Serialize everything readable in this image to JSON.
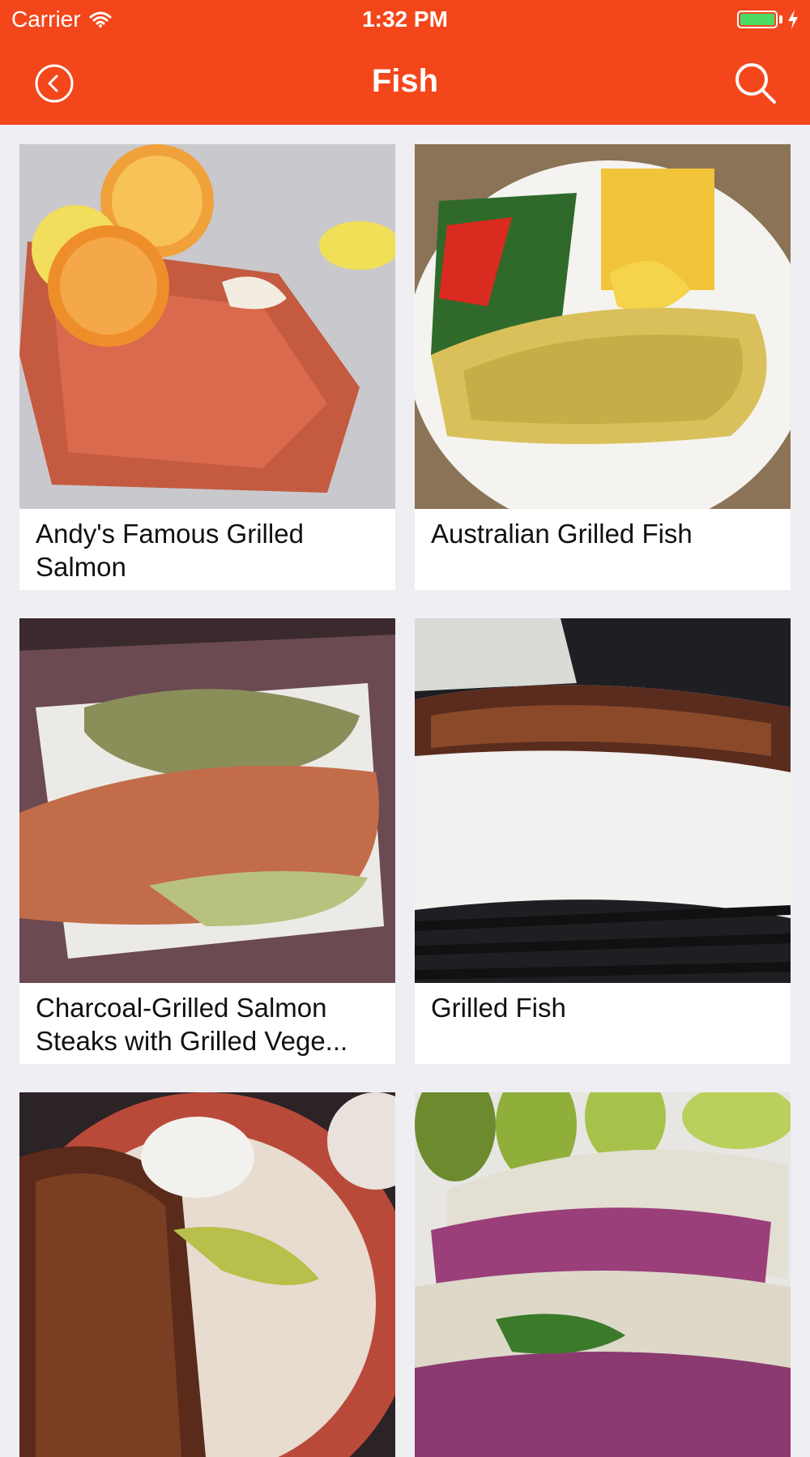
{
  "status_bar": {
    "carrier": "Carrier",
    "time": "1:32 PM",
    "wifi_icon": "wifi-icon",
    "battery_icon": "battery-icon",
    "charging_icon": "bolt-icon"
  },
  "nav": {
    "title": "Fish",
    "back_icon": "back-circle-icon",
    "search_icon": "search-icon",
    "bar_color": "#f4461b"
  },
  "recipes": [
    {
      "title": "Andy's Famous Grilled Salmon"
    },
    {
      "title": "Australian Grilled Fish"
    },
    {
      "title": "Charcoal-Grilled Salmon Steaks with Grilled Vege..."
    },
    {
      "title": "Grilled Fish"
    },
    {
      "title": ""
    },
    {
      "title": ""
    }
  ]
}
